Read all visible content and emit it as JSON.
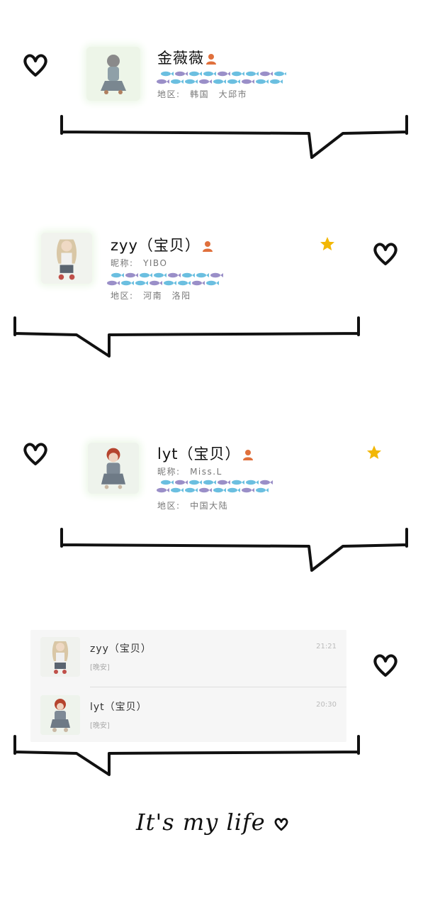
{
  "cards": [
    {
      "name": "金薇薇",
      "nickname_label": "",
      "nickname": "",
      "region_label": "地区:",
      "region": "韩国　大邱市",
      "starred": false
    },
    {
      "name": "zyy（宝贝）",
      "nickname_label": "昵称:",
      "nickname": "YIBO",
      "region_label": "地区:",
      "region": "河南　洛阳",
      "starred": true
    },
    {
      "name": "lyt（宝贝）",
      "nickname_label": "昵称:",
      "nickname": "Miss.L",
      "region_label": "地区:",
      "region": "中国大陆",
      "starred": true
    }
  ],
  "chats": [
    {
      "name": "zyy（宝贝）",
      "message": "[晚安]",
      "time": "21:21"
    },
    {
      "name": "lyt（宝贝）",
      "message": "[晚安]",
      "time": "20:30"
    }
  ],
  "footer": {
    "text": "It's my life"
  },
  "colors": {
    "star": "#f2b705",
    "fish_blue": "#6bbfe0",
    "fish_purple": "#9a8fc8",
    "person_icon": "#e0703c",
    "stroke": "#111111"
  }
}
